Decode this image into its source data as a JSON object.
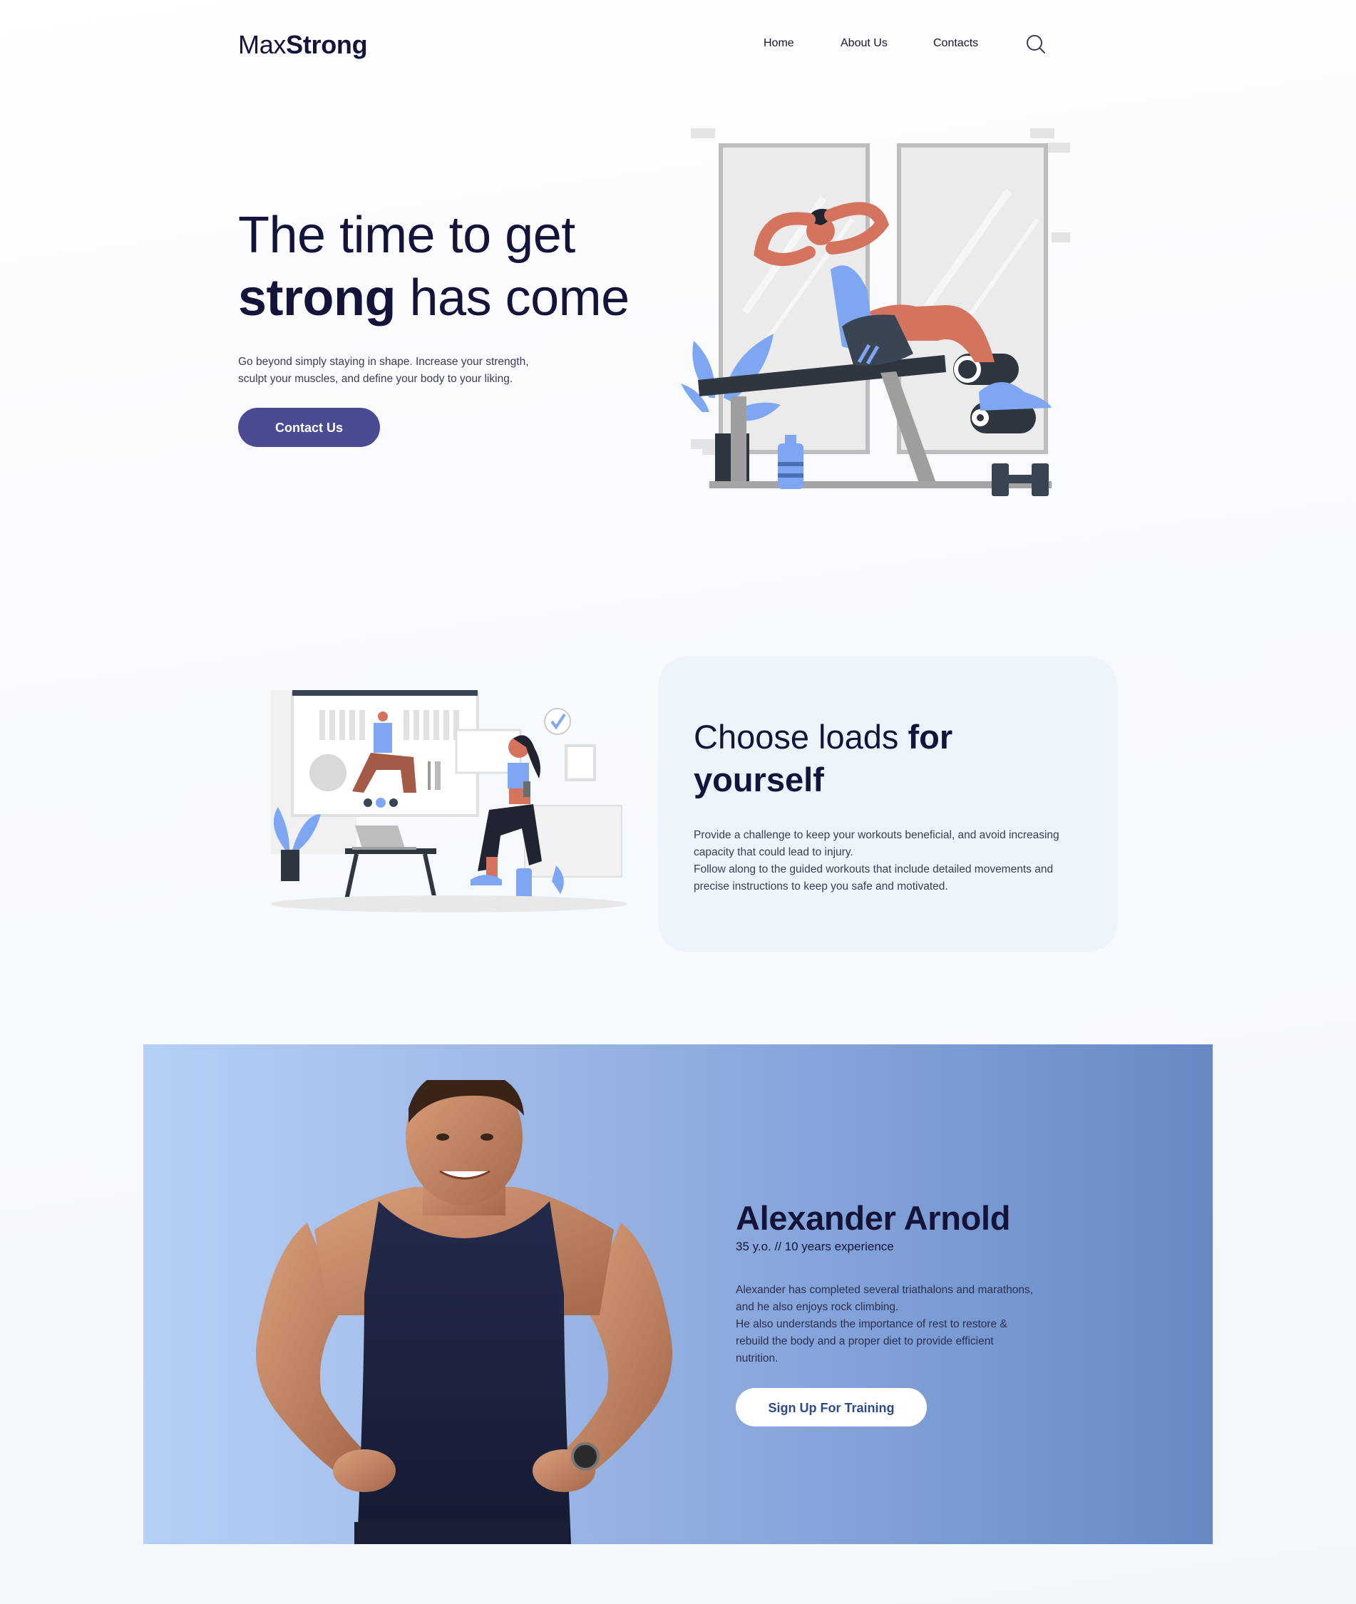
{
  "header": {
    "logo_light": "Max",
    "logo_bold": "Strong",
    "nav": [
      {
        "label": "Home"
      },
      {
        "label": "About Us"
      },
      {
        "label": "Contacts"
      }
    ],
    "search_icon": "search-icon"
  },
  "hero": {
    "title_line1": "The time to get",
    "title_bold": "strong",
    "title_rest": " has come",
    "description_line1": "Go beyond simply staying in shape. Increase your strength,",
    "description_line2": "sculpt your muscles, and define your body to your liking.",
    "cta_label": "Contact Us",
    "illustration": "man-doing-situps-on-bench-illustration"
  },
  "loads": {
    "title_light": "Choose loads ",
    "title_bold_1": "for",
    "title_bold_2": "yourself",
    "paragraph_1": "Provide a challenge to keep your workouts beneficial, and avoid increasing capacity that could lead to injury.",
    "paragraph_2": "Follow along to the guided workouts that include detailed movements and precise instructions to keep you safe and motivated.",
    "illustration": "woman-following-online-workout-illustration"
  },
  "trainer": {
    "name": "Alexander Arnold",
    "meta": "35 y.o. // 10 years experience",
    "bio_1": "Alexander has completed several triathalons and marathons, and he also enjoys rock climbing.",
    "bio_2": "He also understands the importance of rest to restore & rebuild the body and a proper diet to provide efficient nutrition.",
    "cta_label": "Sign Up For Training",
    "photo": "trainer-portrait-photo"
  },
  "colors": {
    "primary": "#4b4b94",
    "heading": "#14143a",
    "accent_blue": "#7ea6f2",
    "accent_coral": "#d4745f",
    "card_bg": "#eef4fc"
  }
}
